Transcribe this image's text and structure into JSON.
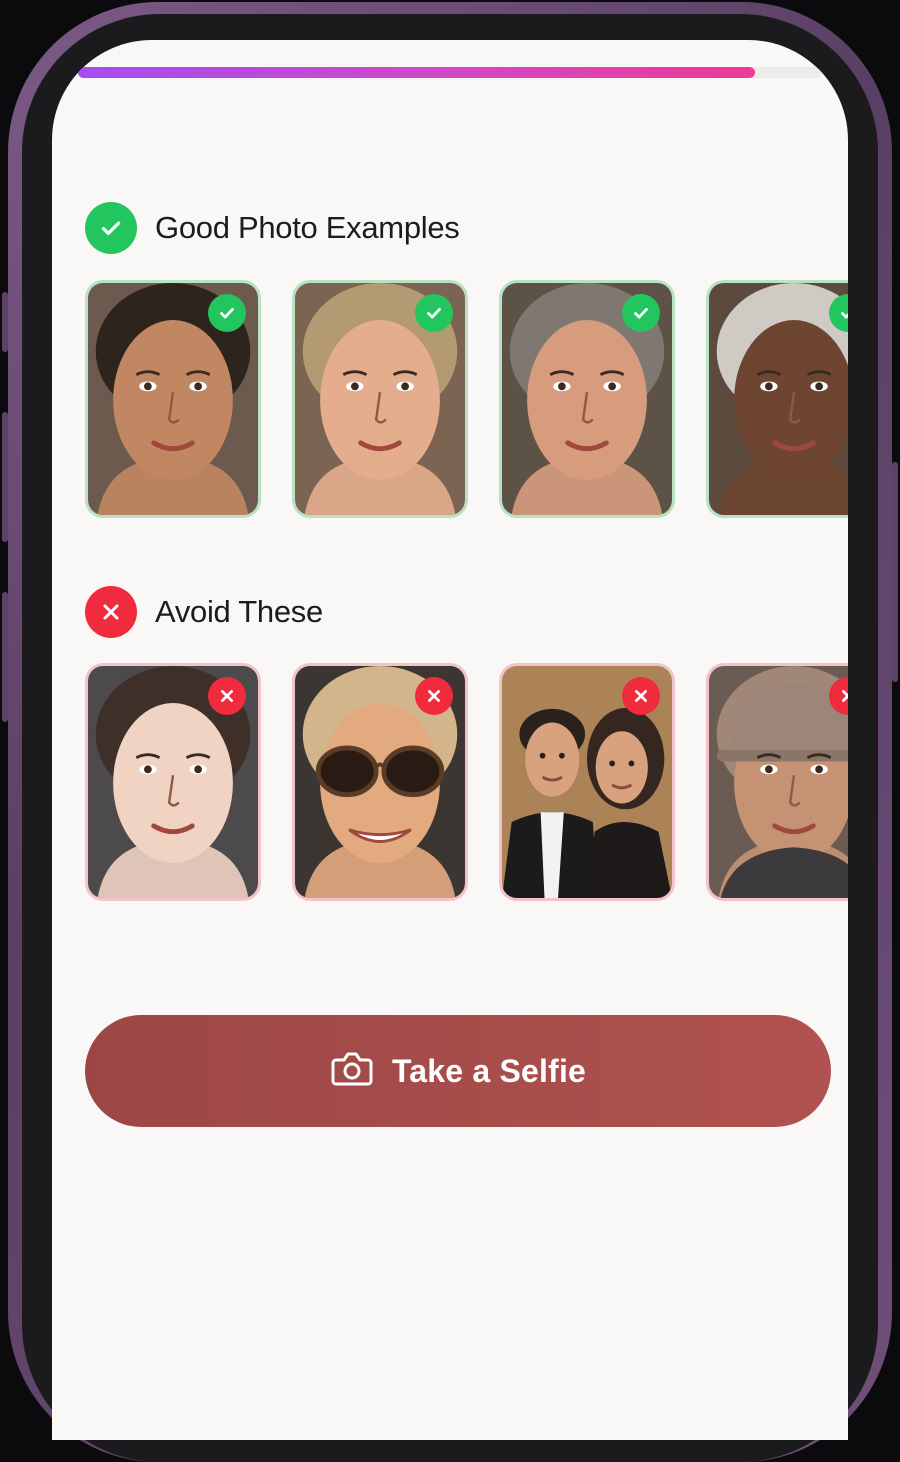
{
  "progress": {
    "value": 0.91
  },
  "colors": {
    "good": "#22c55e",
    "bad": "#ef2b3d",
    "primary_button": "#a94d4a",
    "progress_start": "#a64df0",
    "progress_end": "#ee3b98"
  },
  "good_section": {
    "title": "Good Photo Examples",
    "icon": "check-circle-icon",
    "cards": [
      {
        "badge": "check-icon",
        "skin": "#c18762",
        "hair": "#2e241e",
        "bg": "#6d5a4e"
      },
      {
        "badge": "check-icon",
        "skin": "#e4ad8e",
        "hair": "#b49a73",
        "bg": "#7b6552"
      },
      {
        "badge": "check-icon",
        "skin": "#d79c7e",
        "hair": "#7f7870",
        "bg": "#5d5246"
      },
      {
        "badge": "check-icon",
        "skin": "#6e4530",
        "hair": "#cfcac4",
        "bg": "#5c4a3e"
      }
    ]
  },
  "bad_section": {
    "title": "Avoid These",
    "icon": "x-circle-icon",
    "cards": [
      {
        "badge": "x-icon",
        "skin": "#f0d3c3",
        "hair": "#3e3028",
        "bg": "#4d4a4c",
        "extra": "none"
      },
      {
        "badge": "x-icon",
        "skin": "#e3aa80",
        "hair": "#d2b58a",
        "bg": "#3c3632",
        "extra": "sunglasses"
      },
      {
        "badge": "x-icon",
        "skin": "#d8a27e",
        "hair": "#35261f",
        "bg": "#8e6a4a",
        "extra": "two-people"
      },
      {
        "badge": "x-icon",
        "skin": "#c59373",
        "hair": "#a08778",
        "bg": "#6a5c52",
        "extra": "hat"
      }
    ]
  },
  "button": {
    "label": "Take a Selfie",
    "icon": "camera-icon"
  }
}
